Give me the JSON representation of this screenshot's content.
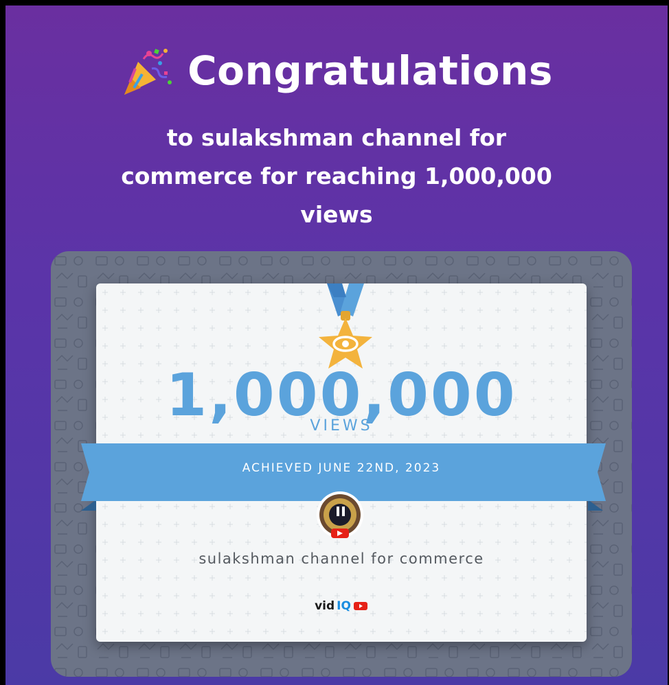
{
  "headline": {
    "title": "Congratulations",
    "icon": "party-popper-icon"
  },
  "subtitle": {
    "line1": "to sulakshman channel for",
    "line2": "commerce for reaching 1,000,000",
    "line3": "views"
  },
  "certificate": {
    "medal_icon": "eye-star-medal-icon",
    "milestone_value": "1,000,000",
    "milestone_unit": "VIEWS",
    "achieved_text": "ACHIEVED JUNE 22ND, 2023",
    "channel_name": "sulakshman channel for commerce",
    "avatar_icon": "channel-avatar-with-youtube-icon",
    "brand_vid": "vid",
    "brand_iq": "IQ",
    "brand_badge_icon": "youtube-badge-icon"
  },
  "colors": {
    "background_top": "#6a2fa0",
    "background_bottom": "#4b3aa6",
    "accent_blue": "#5ba3dc",
    "medal_gold": "#f3b33d",
    "card_gray": "#6c7487",
    "youtube_red": "#e62117"
  }
}
